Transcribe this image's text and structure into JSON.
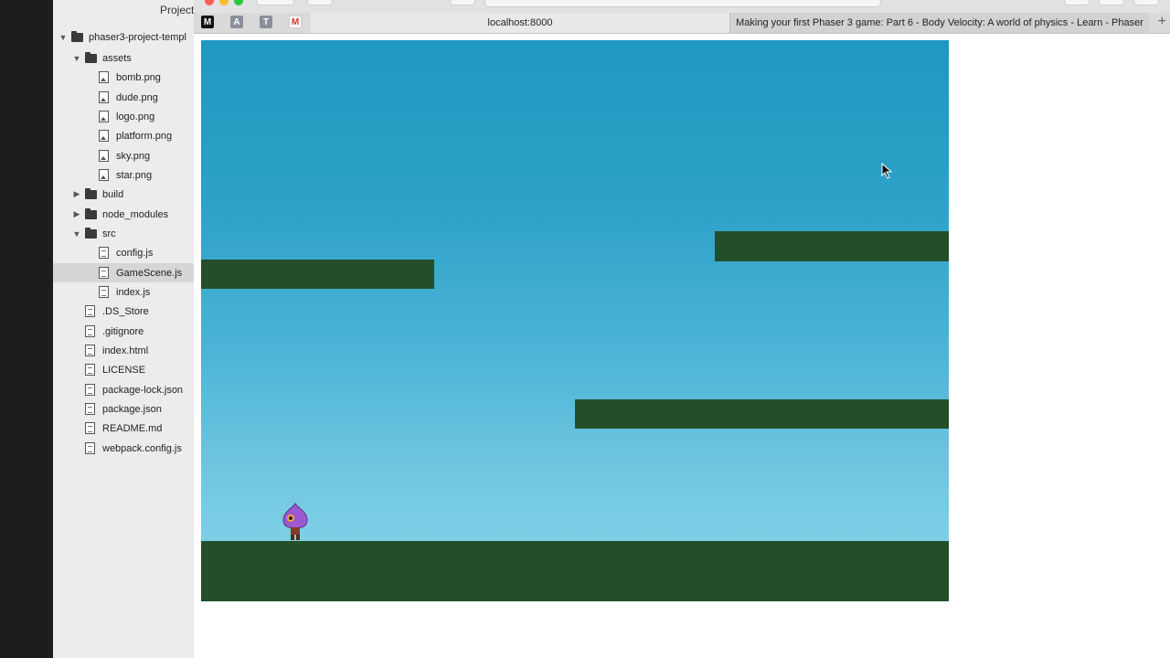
{
  "project_panel": {
    "title": "Project",
    "tree": [
      {
        "label": "phaser3-project-templ",
        "kind": "folder",
        "expanded": true
      },
      {
        "label": "assets",
        "kind": "folder",
        "expanded": true
      },
      {
        "label": "bomb.png",
        "kind": "image"
      },
      {
        "label": "dude.png",
        "kind": "image"
      },
      {
        "label": "logo.png",
        "kind": "image"
      },
      {
        "label": "platform.png",
        "kind": "image"
      },
      {
        "label": "sky.png",
        "kind": "image"
      },
      {
        "label": "star.png",
        "kind": "image"
      },
      {
        "label": "build",
        "kind": "folder",
        "expanded": false
      },
      {
        "label": "node_modules",
        "kind": "folder",
        "expanded": false
      },
      {
        "label": "src",
        "kind": "folder",
        "expanded": true
      },
      {
        "label": "config.js",
        "kind": "file"
      },
      {
        "label": "GameScene.js",
        "kind": "file",
        "selected": true
      },
      {
        "label": "index.js",
        "kind": "file"
      },
      {
        "label": ".DS_Store",
        "kind": "file"
      },
      {
        "label": ".gitignore",
        "kind": "file"
      },
      {
        "label": "index.html",
        "kind": "file"
      },
      {
        "label": "LICENSE",
        "kind": "file"
      },
      {
        "label": "package-lock.json",
        "kind": "file"
      },
      {
        "label": "package.json",
        "kind": "file"
      },
      {
        "label": "README.md",
        "kind": "file"
      },
      {
        "label": "webpack.config.js",
        "kind": "file"
      }
    ]
  },
  "browser": {
    "bookmarks": [
      {
        "label": "M",
        "color": "#111111"
      },
      {
        "label": "A",
        "color": "#8a8f99"
      },
      {
        "label": "T",
        "color": "#8a8f99"
      },
      {
        "label": "M",
        "color": "#d93025"
      }
    ],
    "tabs": [
      {
        "label": "localhost:8000",
        "active": true
      },
      {
        "label": "Making your first Phaser 3 game: Part 6 - Body Velocity: A world of physics - Learn - Phaser",
        "active": false
      }
    ],
    "new_tab_label": "+"
  },
  "game": {
    "colors": {
      "platform": "#224f2a",
      "sky_top": "#1f97bf",
      "sky_bottom": "#8ad7ec",
      "player": "#9b59d0"
    }
  }
}
